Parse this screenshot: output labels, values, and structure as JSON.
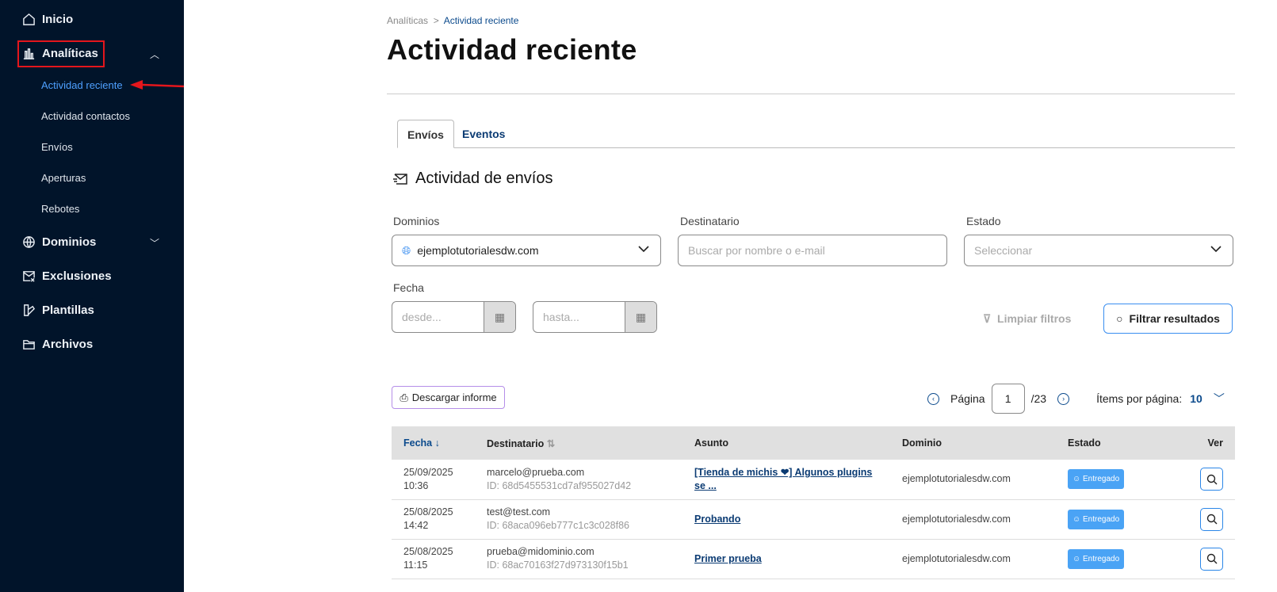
{
  "sidebar": {
    "items": [
      {
        "label": "Inicio",
        "icon": "home-icon"
      },
      {
        "label": "Analíticas",
        "icon": "bar-chart-icon",
        "sub": [
          "Actividad reciente",
          "Actividad contactos",
          "Envíos",
          "Aperturas",
          "Rebotes"
        ]
      },
      {
        "label": "Dominios",
        "icon": "globe-icon"
      },
      {
        "label": "Exclusiones",
        "icon": "mail-x-icon"
      },
      {
        "label": "Plantillas",
        "icon": "template-icon"
      },
      {
        "label": "Archivos",
        "icon": "folder-icon"
      }
    ]
  },
  "breadcrumb": {
    "parent": "Analíticas",
    "current": "Actividad reciente"
  },
  "title": "Actividad reciente",
  "tabs": [
    "Envíos",
    "Eventos"
  ],
  "section": "Actividad de envíos",
  "filters": {
    "dominios_label": "Dominios",
    "dominios_value": "ejemplotutorialesdw.com",
    "dest_label": "Destinatario",
    "dest_placeholder": "Buscar por nombre o e-mail",
    "estado_label": "Estado",
    "estado_placeholder": "Seleccionar",
    "fecha_label": "Fecha",
    "desde": "desde...",
    "hasta": "hasta...",
    "clear": "Limpiar filtros",
    "filter": "Filtrar resultados"
  },
  "download": "Descargar informe",
  "pager": {
    "label": "Página",
    "page": "1",
    "total": "/23",
    "per_label": "Ítems por página:",
    "per": "10"
  },
  "table": {
    "headers": [
      "Fecha",
      "Destinatario",
      "Asunto",
      "Dominio",
      "Estado",
      "Ver"
    ],
    "rows": [
      {
        "date": "25/09/2025",
        "time": "10:36",
        "email": "marcelo@prueba.com",
        "id": "ID: 68d5455531cd7af955027d42",
        "subject": "[Tienda de michis ❤] Algunos plugins se ...",
        "domain": "ejemplotutorialesdw.com",
        "status": "Entregado"
      },
      {
        "date": "25/08/2025",
        "time": "14:42",
        "email": "test@test.com",
        "id": "ID: 68aca096eb777c1c3c028f86",
        "subject": "Probando",
        "domain": "ejemplotutorialesdw.com",
        "status": "Entregado"
      },
      {
        "date": "25/08/2025",
        "time": "11:15",
        "email": "prueba@midominio.com",
        "id": "ID: 68ac70163f27d973130f15b1",
        "subject": "Primer prueba",
        "domain": "ejemplotutorialesdw.com",
        "status": "Entregado"
      }
    ]
  }
}
